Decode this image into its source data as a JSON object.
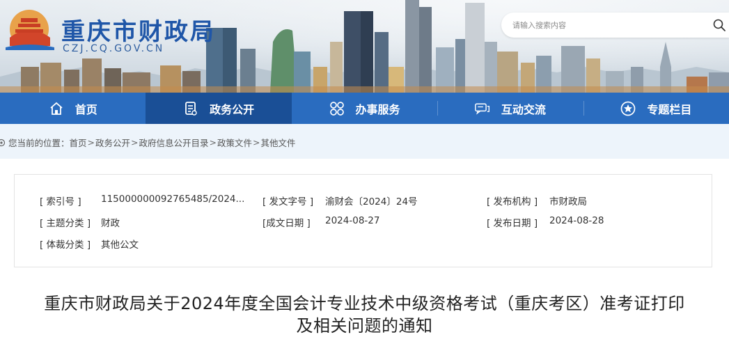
{
  "header": {
    "site_title": "重庆市财政局",
    "site_domain": "CZJ.CQ.GOV.CN",
    "search": {
      "placeholder": "请输入搜索内容"
    }
  },
  "nav": {
    "items": [
      {
        "label": "首页",
        "icon": "home-icon"
      },
      {
        "label": "政务公开",
        "icon": "document-icon",
        "active": true
      },
      {
        "label": "办事服务",
        "icon": "grid-icon"
      },
      {
        "label": "互动交流",
        "icon": "chat-icon"
      },
      {
        "label": "专题栏目",
        "icon": "star-icon"
      }
    ]
  },
  "breadcrumb": {
    "prefix": "您当前的位置：",
    "items": [
      "首页",
      "政务公开",
      "政府信息公开目录",
      "政策文件",
      "其他文件"
    ],
    "separator": ">"
  },
  "info": {
    "index_label": "[ 索引号 ]",
    "index_value": "115000000092765485/2024...",
    "doc_no_label": "[ 发文字号 ]",
    "doc_no_value": "渝财会〔2024〕24号",
    "publisher_label": "[ 发布机构 ]",
    "publisher_value": "市财政局",
    "topic_label": "[ 主题分类 ]",
    "topic_value": "财政",
    "created_label": "[成文日期 ]",
    "created_value": "2024-08-27",
    "published_label": "[ 发布日期 ]",
    "published_value": "2024-08-28",
    "genre_label": "[ 体裁分类 ]",
    "genre_value": "其他公文"
  },
  "title": {
    "line1": "重庆市财政局关于2024年度全国会计专业技术中级资格考试（重庆考区）准考证打印",
    "line2": "及相关问题的通知"
  },
  "colors": {
    "nav_bg": "#2a6cbf",
    "nav_active": "#1a4f96",
    "brand_blue": "#1f56a8",
    "breadcrumb_bg": "#edf4fb"
  }
}
